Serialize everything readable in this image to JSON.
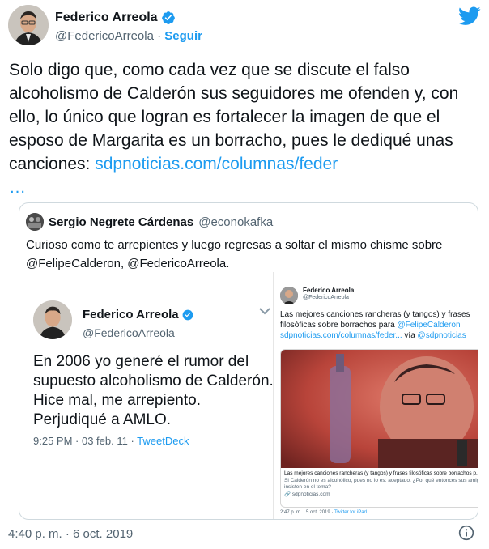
{
  "author": {
    "name": "Federico Arreola",
    "handle": "@FedericoArreola",
    "separator": "·",
    "follow_label": "Seguir"
  },
  "tweet": {
    "text": "Solo digo que, como cada vez que se discute el falso alcoholismo de Calderón sus seguidores me ofenden y, con ello, lo único que logran es fortalecer la imagen de que el esposo de Margarita es un borracho, pues le dediqué unas canciones: ",
    "link": "sdpnoticias.com/columnas/feder",
    "ellipsis": "…"
  },
  "quote": {
    "name": "Sergio Negrete Cárdenas",
    "handle": "@econokafka",
    "text": "Curioso como te arrepientes y luego regresas a soltar el mismo chisme sobre @FelipeCalderon, @FedericoArreola."
  },
  "screenshot1": {
    "name": "Federico Arreola",
    "handle": "@FedericoArreola",
    "text": "En 2006 yo generé el rumor del supuesto alcoholismo de Calderón. Hice mal, me arrepiento. Perjudiqué a AMLO.",
    "time": "9:25 PM · 03 feb. 11 · ",
    "source": "TweetDeck"
  },
  "screenshot2": {
    "name": "Federico Arreola",
    "handle": "@FedericoArreola",
    "text_a": "Las mejores canciones rancheras (y tangos) y frases filosóficas sobre borrachos para ",
    "mention": "@FelipeCalderon",
    "link": "sdpnoticias.com/columnas/feder...",
    "via": " vía ",
    "via_handle": "@sdpnoticias",
    "card_title": "Las mejores canciones rancheras (y tangos) y frases filosóficas sobre borrachos p...",
    "card_desc": "Si Calderón no es alcohólico, pues no lo es: aceptado. ¿Por qué entonces sus amigos insisten en el tema?",
    "card_domain": "🔗 sdpnoticias.com",
    "meta": "2:47 p. m. · 5 oct. 2019 · ",
    "meta_source": "Twitter for iPad"
  },
  "footer": {
    "timestamp": "4:40 p. m. · 6 oct. 2019"
  },
  "colors": {
    "accent": "#1d9bf0",
    "text": "#0f1419",
    "muted": "#536471",
    "border": "#cfd9de"
  },
  "icons": [
    "verified-badge-icon",
    "twitter-bird-icon",
    "chevron-down-icon",
    "info-icon"
  ]
}
